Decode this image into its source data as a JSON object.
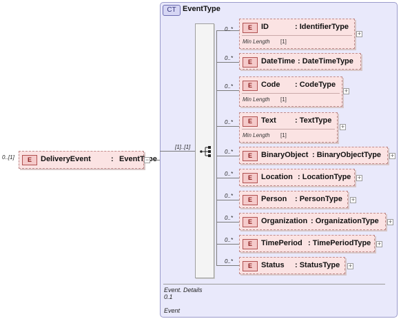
{
  "root": {
    "cardinality": "0..[1]",
    "badge": "E",
    "name": "DeliveryEvent",
    "type_sep": ":",
    "type": "EventType",
    "toggle": "−"
  },
  "complex_type": {
    "badge": "CT",
    "name": "EventType"
  },
  "sequence": {
    "cardinality": "[1]..[1]"
  },
  "children": [
    {
      "card": "0..*",
      "name": "ID",
      "type": ": IdentifierType",
      "facet_label": "Min Length",
      "facet_value": "[1]"
    },
    {
      "card": "0..*",
      "name": "DateTime",
      "type": ": DateTimeType"
    },
    {
      "card": "0..*",
      "name": "Code",
      "type": ": CodeType",
      "facet_label": "Min Length",
      "facet_value": "[1]"
    },
    {
      "card": "0..*",
      "name": "Text",
      "type": ": TextType",
      "facet_label": "Min Length",
      "facet_value": "[1]"
    },
    {
      "card": "0..*",
      "name": "BinaryObject",
      "type": ": BinaryObjectType"
    },
    {
      "card": "0..*",
      "name": "Location",
      "type": ": LocationType"
    },
    {
      "card": "0..*",
      "name": "Person",
      "type": ": PersonType"
    },
    {
      "card": "0..*",
      "name": "Organization",
      "type": ": OrganizationType"
    },
    {
      "card": "0..*",
      "name": "TimePeriod",
      "type": ": TimePeriodType"
    },
    {
      "card": "0..*",
      "name": "Status",
      "type": ": StatusType"
    }
  ],
  "element_badge": "E",
  "expand_symbol": "+",
  "info": {
    "name": "Event. Details",
    "version": "0.1",
    "term": "Event"
  },
  "colors": {
    "container_bg": "#e9e9fb",
    "element_bg": "#fbe3e3",
    "element_border": "#c08a8a"
  }
}
